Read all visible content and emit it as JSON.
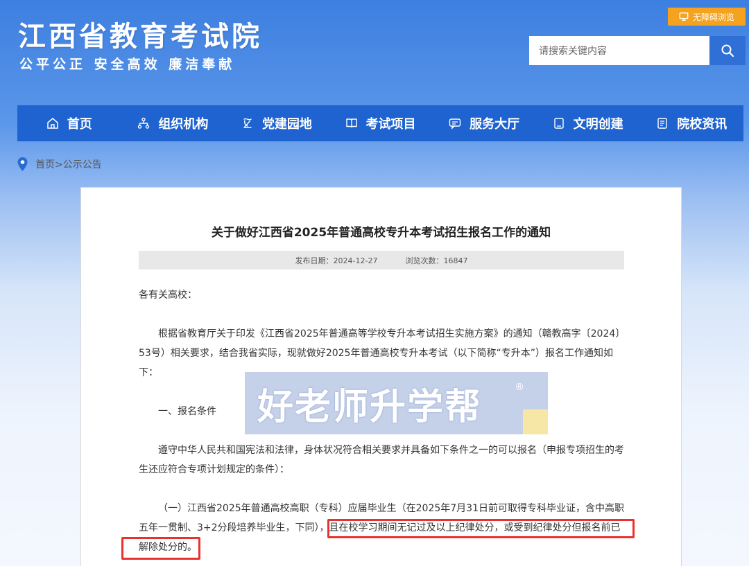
{
  "header": {
    "title": "江西省教育考试院",
    "slogan": "公平公正  安全高效  廉洁奉献",
    "accessibility_label": "无障碍浏览",
    "search_placeholder": "请搜索关键内容"
  },
  "nav": {
    "items": [
      {
        "label": "首页",
        "icon": "home-icon"
      },
      {
        "label": "组织机构",
        "icon": "org-chart-icon"
      },
      {
        "label": "党建园地",
        "icon": "party-icon"
      },
      {
        "label": "考试项目",
        "icon": "book-icon"
      },
      {
        "label": "服务大厅",
        "icon": "service-icon"
      },
      {
        "label": "文明创建",
        "icon": "document-icon"
      },
      {
        "label": "院校资讯",
        "icon": "news-icon"
      }
    ]
  },
  "breadcrumb": {
    "home": "首页",
    "separator": ">",
    "current": "公示公告"
  },
  "article": {
    "title": "关于做好江西省2025年普通高校专升本考试招生报名工作的通知",
    "publish_date_label": "发布日期：",
    "publish_date": "2024-12-27",
    "views_label": "浏览次数：",
    "views": "16847",
    "salutation": "各有关高校：",
    "intro": "根据省教育厅关于印发《江西省2025年普通高等学校专升本考试招生实施方案》的通知（赣教高字〔2024〕53号）相关要求，结合我省实际，现就做好2025年普通高校专升本考试（以下简称“专升本”）报名工作通知如下：",
    "section1_title": "一、报名条件",
    "section1_text": "遵守中华人民共和国宪法和法律，身体状况符合相关要求并具备如下条件之一的可以报名（申报专项招生的考生还应符合专项计划规定的条件）：",
    "item1_line1": "（一）江西省2025年普通高校高职（专科）应届毕业生（在2025年7月31日前可取得专科毕业证，含中高职",
    "item1_line2_a": "五年一贯制、3+2分段培养毕业生，下同），",
    "item1_line2_b": "且在校学习期间无记过及以上纪律处分，或受到纪律处分但报名前已",
    "item1_line3": "解除处分的。"
  },
  "watermark": {
    "text": "好老师升学帮",
    "mark": "®"
  },
  "colors": {
    "nav_bg": "#1e63cf",
    "accent_orange": "#f5a21f",
    "highlight_red": "#e8322d"
  }
}
